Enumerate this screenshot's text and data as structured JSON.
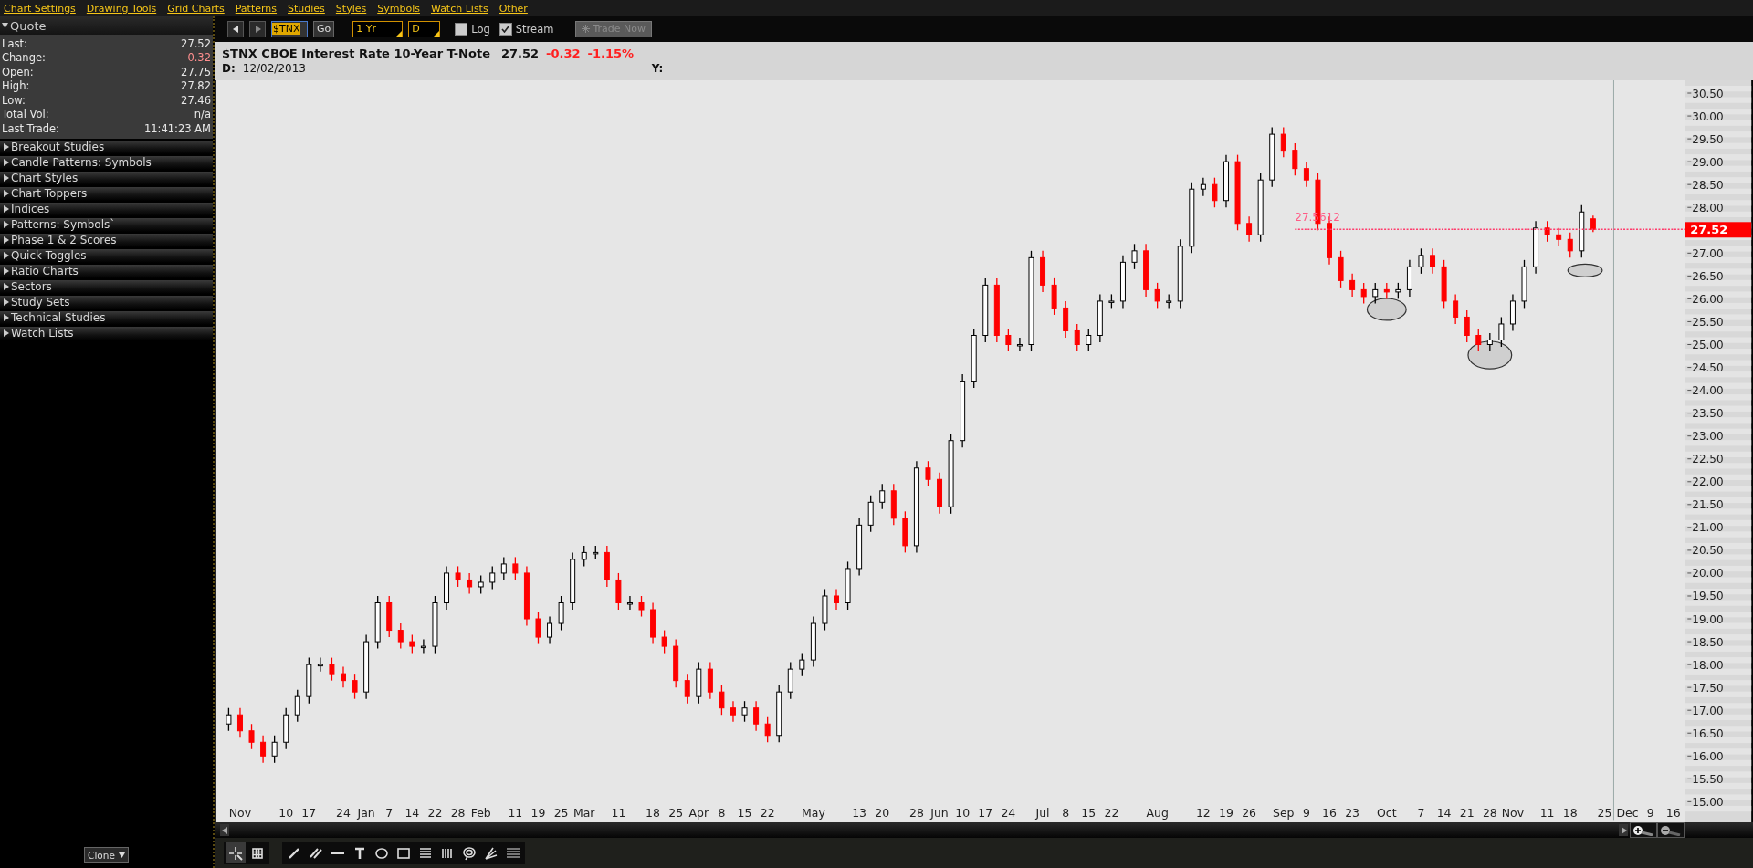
{
  "menu": [
    "Chart Settings",
    "Drawing Tools",
    "Grid Charts",
    "Patterns",
    "Studies",
    "Styles",
    "Symbols",
    "Watch Lists",
    "Other"
  ],
  "sidebar": {
    "quote": {
      "title": "Quote",
      "expanded": true,
      "rows": [
        {
          "label": "Last:",
          "value": "27.52",
          "negative": false
        },
        {
          "label": "Change:",
          "value": "-0.32",
          "negative": true
        },
        {
          "label": "Open:",
          "value": "27.75",
          "negative": false
        },
        {
          "label": "High:",
          "value": "27.82",
          "negative": false
        },
        {
          "label": "Low:",
          "value": "27.46",
          "negative": false
        },
        {
          "label": "Total Vol:",
          "value": "n/a",
          "negative": false
        },
        {
          "label": "Last Trade:",
          "value": "11:41:23 AM",
          "negative": false
        }
      ]
    },
    "sections": [
      "Breakout Studies",
      "Candle Patterns: Symbols",
      "Chart Styles",
      "Chart Toppers",
      "Indices",
      "Patterns: Symbols`",
      "Phase 1 & 2 Scores",
      "Quick Toggles",
      "Ratio Charts",
      "Sectors",
      "Study Sets",
      "Technical Studies",
      "Watch Lists"
    ],
    "clone_button": "Clone"
  },
  "toolbar": {
    "symbol": "$TNX",
    "go": "Go",
    "period": "1 Yr",
    "interval": "D",
    "log": {
      "label": "Log",
      "checked": false
    },
    "stream": {
      "label": "Stream",
      "checked": true
    },
    "trade_now": {
      "label": "Trade Now",
      "disabled": true
    }
  },
  "header": {
    "symbol": "$TNX",
    "name": "CBOE Interest Rate 10-Year T-Note",
    "last": "27.52",
    "change": "-0.32",
    "change_pct": "-1.15%",
    "date_label": "D:",
    "date": "12/02/2013",
    "y_label": "Y:"
  },
  "chart_data": {
    "type": "candlestick",
    "categories": [
      null,
      "Nov",
      null,
      null,
      null,
      "10",
      null,
      "17",
      null,
      null,
      "24",
      null,
      "Jan",
      null,
      "7",
      null,
      "14",
      null,
      "22",
      null,
      "28",
      null,
      "Feb",
      null,
      null,
      "11",
      null,
      "19",
      null,
      "25",
      null,
      "Mar",
      null,
      null,
      "11",
      null,
      null,
      "18",
      null,
      "25",
      null,
      "Apr",
      null,
      "8",
      null,
      "15",
      null,
      "22",
      null,
      null,
      null,
      "May",
      null,
      null,
      null,
      "13",
      null,
      "20",
      null,
      null,
      "28",
      null,
      "Jun",
      null,
      "10",
      null,
      "17",
      null,
      "24",
      null,
      null,
      "Jul",
      null,
      "8",
      null,
      "15",
      null,
      "22",
      null,
      null,
      null,
      "Aug",
      null,
      null,
      null,
      "12",
      null,
      "19",
      null,
      "26",
      null,
      null,
      "Sep",
      null,
      "9",
      null,
      "16",
      null,
      "23",
      null,
      null,
      "Oct",
      null,
      null,
      "7",
      null,
      "14",
      null,
      "21",
      null,
      "28",
      null,
      "Nov",
      null,
      null,
      "11",
      null,
      "18",
      null,
      null,
      "25",
      null,
      "Dec",
      null,
      "9",
      null,
      "16"
    ],
    "ohlc": [
      [
        16.7,
        17.05,
        16.55,
        16.9
      ],
      [
        16.9,
        17.05,
        16.4,
        16.55
      ],
      [
        16.55,
        16.7,
        16.15,
        16.3
      ],
      [
        16.3,
        16.45,
        15.85,
        16.0
      ],
      [
        16.0,
        16.45,
        15.85,
        16.3
      ],
      [
        16.3,
        17.05,
        16.15,
        16.9
      ],
      [
        16.9,
        17.45,
        16.75,
        17.3
      ],
      [
        17.3,
        18.15,
        17.15,
        18.0
      ],
      [
        18.0,
        18.15,
        17.85,
        18.0
      ],
      [
        18.0,
        18.15,
        17.65,
        17.8
      ],
      [
        17.8,
        17.95,
        17.5,
        17.65
      ],
      [
        17.65,
        17.8,
        17.25,
        17.4
      ],
      [
        17.4,
        18.65,
        17.25,
        18.5
      ],
      [
        18.5,
        19.5,
        18.35,
        19.35
      ],
      [
        19.35,
        19.5,
        18.6,
        18.75
      ],
      [
        18.75,
        18.9,
        18.35,
        18.5
      ],
      [
        18.5,
        18.65,
        18.25,
        18.4
      ],
      [
        18.4,
        18.55,
        18.25,
        18.4
      ],
      [
        18.4,
        19.5,
        18.25,
        19.35
      ],
      [
        19.35,
        20.15,
        19.2,
        20.0
      ],
      [
        20.0,
        20.15,
        19.7,
        19.85
      ],
      [
        19.85,
        20.0,
        19.55,
        19.7
      ],
      [
        19.7,
        19.95,
        19.55,
        19.8
      ],
      [
        19.8,
        20.15,
        19.65,
        20.0
      ],
      [
        20.0,
        20.35,
        19.85,
        20.2
      ],
      [
        20.2,
        20.35,
        19.85,
        20.0
      ],
      [
        20.0,
        20.15,
        18.85,
        19.0
      ],
      [
        19.0,
        19.15,
        18.45,
        18.6
      ],
      [
        18.6,
        19.05,
        18.45,
        18.9
      ],
      [
        18.9,
        19.5,
        18.75,
        19.35
      ],
      [
        19.35,
        20.45,
        19.2,
        20.3
      ],
      [
        20.3,
        20.6,
        20.15,
        20.45
      ],
      [
        20.45,
        20.6,
        20.3,
        20.45
      ],
      [
        20.45,
        20.6,
        19.7,
        19.85
      ],
      [
        19.85,
        20.0,
        19.2,
        19.35
      ],
      [
        19.35,
        19.5,
        19.2,
        19.35
      ],
      [
        19.35,
        19.5,
        19.05,
        19.2
      ],
      [
        19.2,
        19.35,
        18.45,
        18.6
      ],
      [
        18.6,
        18.75,
        18.25,
        18.4
      ],
      [
        18.4,
        18.55,
        17.5,
        17.65
      ],
      [
        17.65,
        17.8,
        17.15,
        17.3
      ],
      [
        17.3,
        18.05,
        17.15,
        17.9
      ],
      [
        17.9,
        18.05,
        17.25,
        17.4
      ],
      [
        17.4,
        17.55,
        16.9,
        17.05
      ],
      [
        17.05,
        17.2,
        16.75,
        16.9
      ],
      [
        16.9,
        17.2,
        16.75,
        17.05
      ],
      [
        17.05,
        17.2,
        16.55,
        16.7
      ],
      [
        16.7,
        16.85,
        16.3,
        16.45
      ],
      [
        16.45,
        17.55,
        16.3,
        17.4
      ],
      [
        17.4,
        18.05,
        17.25,
        17.9
      ],
      [
        17.9,
        18.25,
        17.75,
        18.1
      ],
      [
        18.1,
        19.05,
        17.95,
        18.9
      ],
      [
        18.9,
        19.65,
        18.75,
        19.5
      ],
      [
        19.5,
        19.65,
        19.2,
        19.35
      ],
      [
        19.35,
        20.25,
        19.2,
        20.1
      ],
      [
        20.1,
        21.2,
        19.95,
        21.05
      ],
      [
        21.05,
        21.7,
        20.9,
        21.55
      ],
      [
        21.55,
        21.95,
        21.4,
        21.8
      ],
      [
        21.8,
        21.95,
        21.05,
        21.2
      ],
      [
        21.2,
        21.35,
        20.45,
        20.6
      ],
      [
        20.6,
        22.45,
        20.45,
        22.3
      ],
      [
        22.3,
        22.45,
        21.9,
        22.05
      ],
      [
        22.05,
        22.2,
        21.3,
        21.45
      ],
      [
        21.45,
        23.05,
        21.3,
        22.9
      ],
      [
        22.9,
        24.35,
        22.75,
        24.2
      ],
      [
        24.2,
        25.35,
        24.05,
        25.2
      ],
      [
        25.2,
        26.45,
        25.05,
        26.3
      ],
      [
        26.3,
        26.45,
        25.05,
        25.2
      ],
      [
        25.2,
        25.35,
        24.85,
        25.0
      ],
      [
        25.0,
        25.15,
        24.85,
        25.0
      ],
      [
        25.0,
        27.05,
        24.85,
        26.9
      ],
      [
        26.9,
        27.05,
        26.15,
        26.3
      ],
      [
        26.3,
        26.45,
        25.65,
        25.8
      ],
      [
        25.8,
        25.95,
        25.15,
        25.3
      ],
      [
        25.3,
        25.45,
        24.85,
        25.0
      ],
      [
        25.0,
        25.35,
        24.85,
        25.2
      ],
      [
        25.2,
        26.1,
        25.05,
        25.95
      ],
      [
        25.95,
        26.1,
        25.8,
        25.95
      ],
      [
        25.95,
        26.95,
        25.8,
        26.8
      ],
      [
        26.8,
        27.2,
        26.65,
        27.05
      ],
      [
        27.05,
        27.2,
        26.05,
        26.2
      ],
      [
        26.2,
        26.35,
        25.8,
        25.95
      ],
      [
        25.95,
        26.1,
        25.8,
        25.95
      ],
      [
        25.95,
        27.3,
        25.8,
        27.15
      ],
      [
        27.15,
        28.55,
        27.0,
        28.4
      ],
      [
        28.4,
        28.65,
        28.25,
        28.5
      ],
      [
        28.5,
        28.65,
        28.0,
        28.15
      ],
      [
        28.15,
        29.15,
        28.0,
        29.0
      ],
      [
        29.0,
        29.15,
        27.5,
        27.65
      ],
      [
        27.65,
        27.8,
        27.25,
        27.4
      ],
      [
        27.4,
        28.75,
        27.25,
        28.6
      ],
      [
        28.6,
        29.75,
        28.45,
        29.6
      ],
      [
        29.6,
        29.75,
        29.1,
        29.25
      ],
      [
        29.25,
        29.4,
        28.7,
        28.85
      ],
      [
        28.85,
        29.0,
        28.45,
        28.6
      ],
      [
        28.6,
        28.75,
        27.5,
        27.65
      ],
      [
        27.65,
        27.8,
        26.75,
        26.9
      ],
      [
        26.9,
        27.05,
        26.25,
        26.4
      ],
      [
        26.4,
        26.55,
        26.05,
        26.2
      ],
      [
        26.2,
        26.35,
        25.9,
        26.05
      ],
      [
        26.05,
        26.35,
        25.9,
        26.2
      ],
      [
        26.2,
        26.35,
        26.0,
        26.15
      ],
      [
        26.15,
        26.35,
        26.0,
        26.2
      ],
      [
        26.2,
        26.85,
        26.05,
        26.7
      ],
      [
        26.7,
        27.1,
        26.55,
        26.95
      ],
      [
        26.95,
        27.1,
        26.55,
        26.7
      ],
      [
        26.7,
        26.85,
        25.8,
        25.95
      ],
      [
        25.95,
        26.1,
        25.45,
        25.6
      ],
      [
        25.6,
        25.75,
        25.05,
        25.2
      ],
      [
        25.2,
        25.35,
        24.85,
        25.0
      ],
      [
        25.0,
        25.25,
        24.85,
        25.1
      ],
      [
        25.1,
        25.6,
        24.95,
        25.45
      ],
      [
        25.45,
        26.1,
        25.3,
        25.95
      ],
      [
        25.95,
        26.85,
        25.8,
        26.7
      ],
      [
        26.7,
        27.7,
        26.55,
        27.55
      ],
      [
        27.55,
        27.7,
        27.25,
        27.4
      ],
      [
        27.4,
        27.55,
        27.15,
        27.3
      ],
      [
        27.3,
        27.45,
        26.9,
        27.05
      ],
      [
        27.05,
        28.05,
        26.9,
        27.9
      ],
      [
        27.75,
        27.82,
        27.46,
        27.52
      ],
      null,
      null,
      null,
      null,
      null,
      null,
      null
    ],
    "ylim": [
      14.54,
      30.78
    ],
    "yticks": [
      {
        "value": 15,
        "label": "15.00"
      },
      {
        "value": 15.5,
        "label": "15.50"
      },
      {
        "value": 16,
        "label": "16.00"
      },
      {
        "value": 16.5,
        "label": "16.50"
      },
      {
        "value": 17,
        "label": "17.00"
      },
      {
        "value": 17.5,
        "label": "17.50"
      },
      {
        "value": 18,
        "label": "18.00"
      },
      {
        "value": 18.5,
        "label": "18.50"
      },
      {
        "value": 19,
        "label": "19.00"
      },
      {
        "value": 19.5,
        "label": "19.50"
      },
      {
        "value": 20,
        "label": "20.00"
      },
      {
        "value": 20.5,
        "label": "20.50"
      },
      {
        "value": 21,
        "label": "21.00"
      },
      {
        "value": 21.5,
        "label": "21.50"
      },
      {
        "value": 22,
        "label": "22.00"
      },
      {
        "value": 22.5,
        "label": "22.50"
      },
      {
        "value": 23,
        "label": "23.00"
      },
      {
        "value": 23.5,
        "label": "23.50"
      },
      {
        "value": 24,
        "label": "24.00"
      },
      {
        "value": 24.5,
        "label": "24.50"
      },
      {
        "value": 25,
        "label": "25.00"
      },
      {
        "value": 25.5,
        "label": "25.50"
      },
      {
        "value": 26,
        "label": "26.00"
      },
      {
        "value": 26.5,
        "label": "26.50"
      },
      {
        "value": 27,
        "label": "27.00"
      },
      {
        "value": 28,
        "label": "28.00"
      },
      {
        "value": 28.5,
        "label": "28.50"
      },
      {
        "value": 29,
        "label": "29.00"
      },
      {
        "value": 29.5,
        "label": "29.50"
      },
      {
        "value": 30,
        "label": "30.00"
      },
      {
        "value": 30.5,
        "label": "30.50"
      }
    ]
  },
  "chart_overlay": {
    "price_line_label": "27.5612",
    "price_tag": "27.52",
    "drawings": [
      {
        "kind": "ellipse"
      },
      {
        "kind": "ellipse"
      },
      {
        "kind": "ellipse"
      }
    ]
  },
  "drawing_tools": [
    {
      "kind": "pointer",
      "selected": true
    },
    {
      "kind": "grid",
      "selected": false
    },
    {
      "kind": "line",
      "selected": false
    },
    {
      "kind": "parallel",
      "selected": false
    },
    {
      "kind": "hline",
      "selected": false
    },
    {
      "kind": "text",
      "selected": false
    },
    {
      "kind": "ellipse",
      "selected": false
    },
    {
      "kind": "rect",
      "selected": false
    },
    {
      "kind": "levels",
      "selected": false
    },
    {
      "kind": "vlines",
      "selected": false
    },
    {
      "kind": "spiral",
      "selected": false
    },
    {
      "kind": "fan",
      "selected": false
    },
    {
      "kind": "bars",
      "selected": false
    }
  ]
}
